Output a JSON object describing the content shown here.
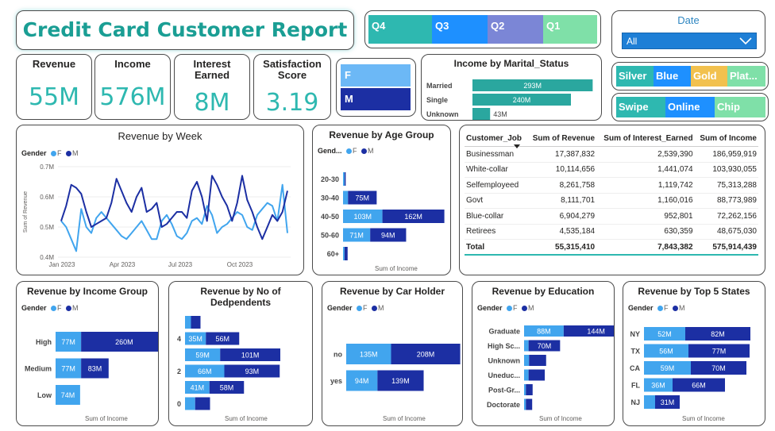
{
  "header": {
    "title": "Credit Card Customer Report"
  },
  "kpis": [
    {
      "label": "Revenue",
      "value": "55M"
    },
    {
      "label": "Income",
      "value": "576M"
    },
    {
      "label": "Interest Earned",
      "value": "8M"
    },
    {
      "label": "Satisfaction Score",
      "value": "3.19"
    }
  ],
  "quarter_slicer": [
    "Q4",
    "Q3",
    "Q2",
    "Q1"
  ],
  "gender_slicer": [
    "F",
    "M"
  ],
  "date_slicer": {
    "label": "Date",
    "value": "All"
  },
  "card_category_slicer": [
    "Silver",
    "Blue",
    "Gold",
    "Plat..."
  ],
  "use_chip_slicer": [
    "Swipe",
    "Online",
    "Chip"
  ],
  "colors": {
    "female": "#41a5ee",
    "male": "#1c2fa3",
    "accent": "#2eb8b0"
  },
  "legend": {
    "title": "Gender",
    "f": "F",
    "m": "M"
  },
  "table": {
    "headers": [
      "Customer_Job",
      "Sum of Revenue",
      "Sum of Interest_Earned",
      "Sum of Income"
    ],
    "rows": [
      [
        "Businessman",
        "17,387,832",
        "2,539,390",
        "186,959,919"
      ],
      [
        "White-collar",
        "10,114,656",
        "1,441,074",
        "103,930,055"
      ],
      [
        "Selfemployeed",
        "8,261,758",
        "1,119,742",
        "75,313,288"
      ],
      [
        "Govt",
        "8,111,701",
        "1,160,016",
        "88,773,989"
      ],
      [
        "Blue-collar",
        "6,904,279",
        "952,801",
        "72,262,156"
      ],
      [
        "Retirees",
        "4,535,184",
        "630,359",
        "48,675,030"
      ]
    ],
    "total": [
      "Total",
      "55,315,410",
      "7,843,382",
      "575,914,439"
    ]
  },
  "chart_data": [
    {
      "id": "marital",
      "type": "bar",
      "title": "Income by Marital_Status",
      "categories": [
        "Married",
        "Single",
        "Unknown"
      ],
      "values": [
        293,
        240,
        43
      ],
      "labels": [
        "293M",
        "240M",
        "43M"
      ]
    },
    {
      "id": "week",
      "type": "line",
      "title": "Revenue by Week",
      "xlabel": "",
      "ylabel": "Sum of Revenue",
      "ylim": [
        0.4,
        0.7
      ],
      "y_ticks": [
        "0.4M",
        "0.5M",
        "0.6M",
        "0.7M"
      ],
      "x_ticks": [
        "Jan 2023",
        "Apr 2023",
        "Jul 2023",
        "Oct 2023"
      ],
      "series": [
        {
          "name": "F",
          "values": [
            0.52,
            0.5,
            0.46,
            0.42,
            0.56,
            0.5,
            0.48,
            0.53,
            0.55,
            0.53,
            0.51,
            0.49,
            0.47,
            0.46,
            0.48,
            0.5,
            0.52,
            0.49,
            0.46,
            0.46,
            0.52,
            0.54,
            0.51,
            0.47,
            0.46,
            0.48,
            0.52,
            0.53,
            0.51,
            0.57,
            0.54,
            0.48,
            0.5,
            0.51,
            0.53,
            0.55,
            0.54,
            0.5,
            0.49,
            0.54,
            0.56,
            0.58,
            0.57,
            0.52,
            0.64,
            0.48
          ]
        },
        {
          "name": "M",
          "values": [
            0.52,
            0.57,
            0.64,
            0.63,
            0.61,
            0.55,
            0.5,
            0.51,
            0.52,
            0.53,
            0.58,
            0.66,
            0.62,
            0.58,
            0.55,
            0.6,
            0.63,
            0.55,
            0.56,
            0.58,
            0.5,
            0.51,
            0.53,
            0.55,
            0.55,
            0.53,
            0.62,
            0.65,
            0.6,
            0.52,
            0.67,
            0.64,
            0.6,
            0.57,
            0.52,
            0.58,
            0.67,
            0.59,
            0.55,
            0.5,
            0.46,
            0.5,
            0.54,
            0.52,
            0.55,
            0.62
          ]
        }
      ]
    },
    {
      "id": "age",
      "type": "bar",
      "title": "Revenue by Age Group",
      "xlabel": "Sum of Income",
      "categories": [
        "20-30",
        "30-40",
        "40-50",
        "50-60",
        "60+"
      ],
      "series": [
        {
          "name": "F",
          "values": [
            4,
            13,
            103,
            71,
            4
          ],
          "labels": [
            "",
            "",
            "103M",
            "71M",
            ""
          ]
        },
        {
          "name": "M",
          "values": [
            3,
            75,
            162,
            94,
            8
          ],
          "labels": [
            "",
            "75M",
            "162M",
            "94M",
            ""
          ]
        }
      ],
      "xmax": 270
    },
    {
      "id": "incomegroup",
      "type": "bar",
      "title": "Revenue by Income Group",
      "xlabel": "Sum of Income",
      "categories": [
        "High",
        "Medium",
        "Low"
      ],
      "series": [
        {
          "name": "F",
          "values": [
            77,
            77,
            74
          ],
          "labels": [
            "77M",
            "77M",
            "74M"
          ]
        },
        {
          "name": "M",
          "values": [
            260,
            83,
            0
          ],
          "labels": [
            "260M",
            "83M",
            ""
          ]
        }
      ],
      "xmax": 400
    },
    {
      "id": "dependents",
      "type": "bar",
      "title": "Revenue by No of Dedpendents",
      "xlabel": "Sum of Income",
      "categories": [
        "5",
        "4",
        "3",
        "2",
        "1",
        "0"
      ],
      "tick_labels": [
        "",
        "4",
        "",
        "2",
        "",
        "0"
      ],
      "series": [
        {
          "name": "F",
          "values": [
            10,
            35,
            59,
            66,
            41,
            17
          ],
          "labels": [
            "",
            "35M",
            "59M",
            "66M",
            "41M",
            ""
          ]
        },
        {
          "name": "M",
          "values": [
            16,
            56,
            101,
            93,
            58,
            25
          ],
          "labels": [
            "",
            "56M",
            "101M",
            "93M",
            "58M",
            ""
          ]
        }
      ],
      "xmax": 220
    },
    {
      "id": "carholder",
      "type": "bar",
      "title": "Revenue by Car Holder",
      "xlabel": "Sum of Income",
      "categories": [
        "no",
        "yes"
      ],
      "series": [
        {
          "name": "F",
          "values": [
            135,
            94
          ],
          "labels": [
            "135M",
            "94M"
          ]
        },
        {
          "name": "M",
          "values": [
            208,
            139
          ],
          "labels": [
            "208M",
            "139M"
          ]
        }
      ],
      "xmax": 430
    },
    {
      "id": "education",
      "type": "bar",
      "title": "Revenue by Education",
      "xlabel": "Sum of Income",
      "categories": [
        "Graduate",
        "High Sc...",
        "Unknown",
        "Uneduc...",
        "Post-Gr...",
        "Doctorate"
      ],
      "series": [
        {
          "name": "F",
          "values": [
            88,
            10,
            11,
            10,
            4,
            4
          ],
          "labels": [
            "88M",
            "",
            "",
            "",
            "",
            ""
          ]
        },
        {
          "name": "M",
          "values": [
            144,
            70,
            38,
            36,
            15,
            14
          ],
          "labels": [
            "144M",
            "70M",
            "",
            "",
            "",
            ""
          ]
        }
      ],
      "xmax": 300
    },
    {
      "id": "states",
      "type": "bar",
      "title": "Revenue by Top 5 States",
      "xlabel": "Sum of Income",
      "categories": [
        "NY",
        "TX",
        "CA",
        "FL",
        "NJ"
      ],
      "series": [
        {
          "name": "F",
          "values": [
            52,
            56,
            59,
            36,
            14
          ],
          "labels": [
            "52M",
            "56M",
            "59M",
            "36M",
            ""
          ]
        },
        {
          "name": "M",
          "values": [
            82,
            77,
            70,
            66,
            31
          ],
          "labels": [
            "82M",
            "77M",
            "70M",
            "66M",
            "31M"
          ]
        }
      ],
      "xmax": 170
    }
  ]
}
